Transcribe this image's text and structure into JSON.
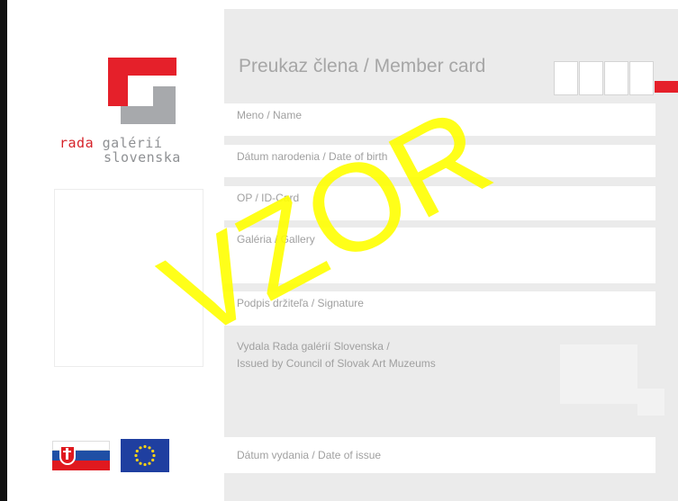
{
  "logo": {
    "name_part1": "rada",
    "name_part2": "galérií",
    "name_part3": "slovenska",
    "brand_red": "#e5202a",
    "brand_grey": "#a7a9ac"
  },
  "card": {
    "title": "Preukaz člena / Member card",
    "fields": [
      {
        "label": "Meno / Name"
      },
      {
        "label": "Dátum narodenia / Date of birth"
      },
      {
        "label": "OP / ID-Card"
      },
      {
        "label": "Galéria / Gallery"
      },
      {
        "label": "Podpis držiteľa / Signature"
      },
      {
        "label": "Dátum vydania / Date of issue"
      }
    ],
    "issued_by_line1": "Vydala Rada galérií Slovenska /",
    "issued_by_line2": "Issued by Council of Slovak Art Muzeums",
    "watermark": "VZOR",
    "watermark_color": "#ffff00",
    "panel_color": "#ebebeb"
  },
  "flags": {
    "left": "slovakia-flag-icon",
    "right": "eu-flag-icon"
  }
}
